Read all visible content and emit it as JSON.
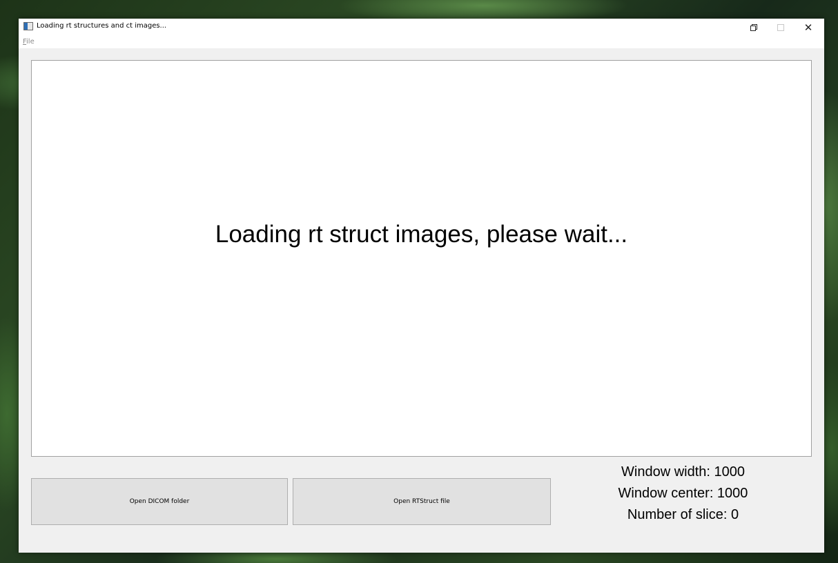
{
  "window": {
    "title": "Loading rt structures and ct images..."
  },
  "menu": {
    "file_first": "F",
    "file_rest": "ile"
  },
  "viewer": {
    "message": "Loading rt struct images, please wait..."
  },
  "buttons": {
    "open_dicom_label": "Open DICOM folder",
    "open_rtstruct_label": "Open RTStruct file"
  },
  "info": {
    "window_width": "Window width: 1000",
    "window_center": "Window center: 1000",
    "number_of_slice": "Number of slice: 0"
  },
  "icons": {
    "app": "app-window-icon",
    "restore": "restore-icon",
    "maximize": "maximize-icon",
    "close": "close-icon"
  }
}
